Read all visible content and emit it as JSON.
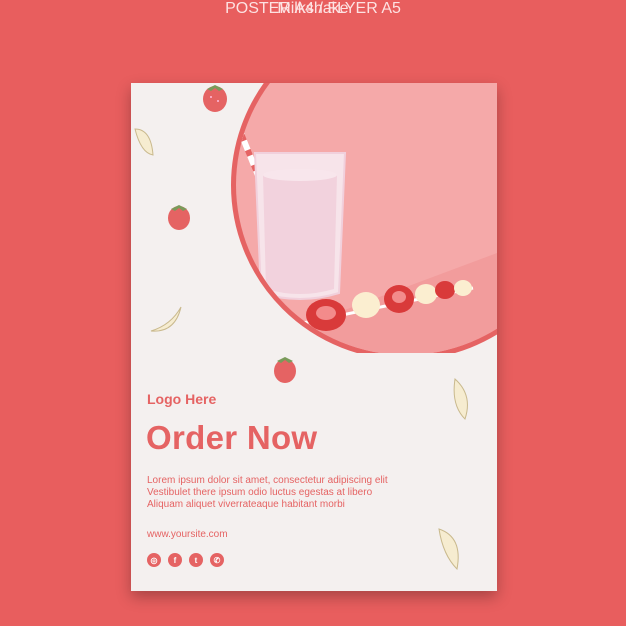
{
  "header": {
    "title": "POSTER A4 / FLYER A5",
    "subtitle": "Milkshake"
  },
  "poster": {
    "logo": "Logo Here",
    "headline": "Order Now",
    "body_lines": [
      "Lorem ipsum dolor sit amet, consectetur adipiscing elit",
      "Vestibulet there ipsum odio luctus egestas at libero",
      "Aliquam aliquet viverrateaque habitant morbi"
    ],
    "url": "www.yoursite.com",
    "social_icons": [
      "instagram-icon",
      "facebook-icon",
      "twitter-icon",
      "whatsapp-icon"
    ]
  },
  "colors": {
    "background": "#e85e5e",
    "poster": "#f4f0ef",
    "accent": "#e56363",
    "photo_bg": "#f5a9a9"
  }
}
